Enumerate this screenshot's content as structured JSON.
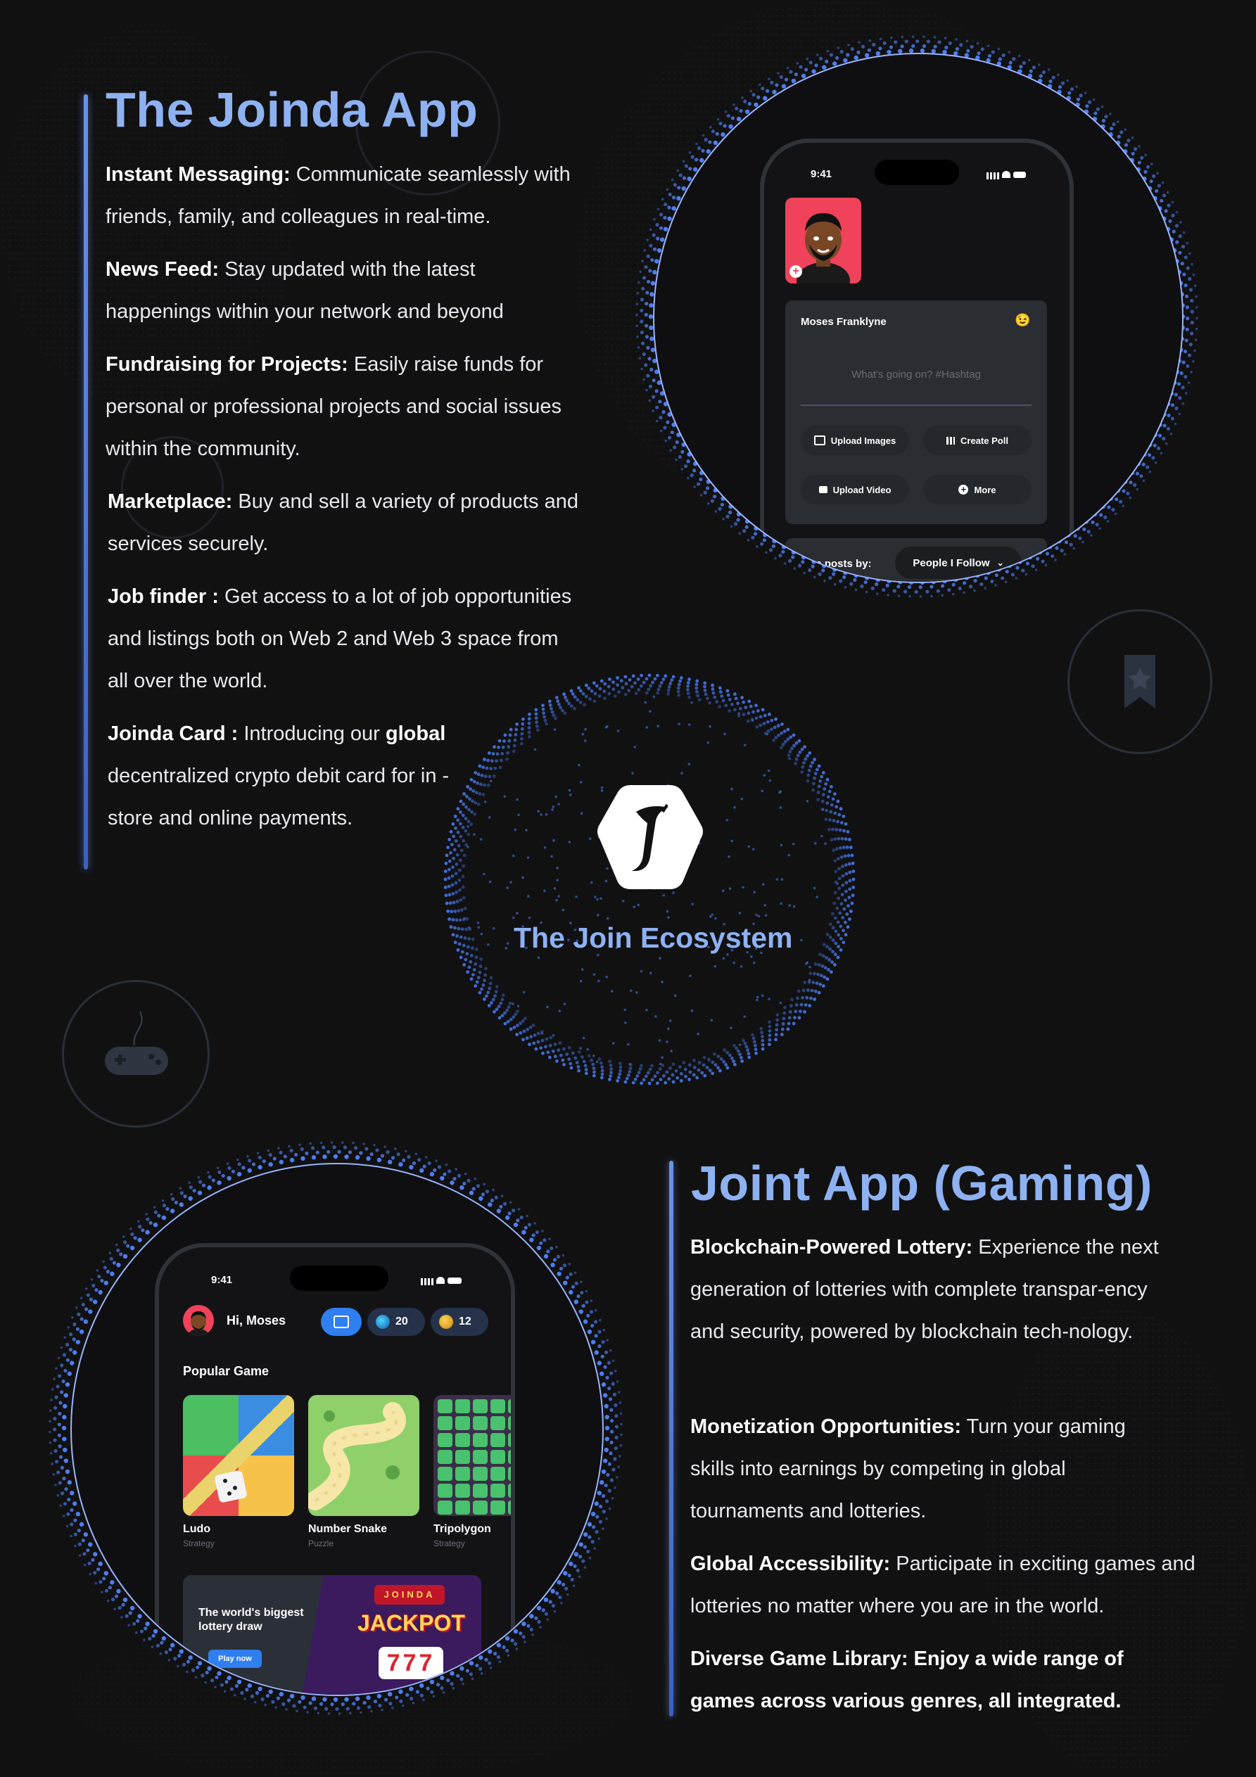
{
  "joinda": {
    "title": "The Joinda App",
    "features": [
      {
        "label": "Instant Messaging:",
        "text": " Communicate seamlessly with friends, family, and colleagues in real-time."
      },
      {
        "label": "News Feed:",
        "text": " Stay updated with the latest happenings within your network and beyond"
      },
      {
        "label": "Fundraising for Projects:",
        "text": " Easily raise funds for personal or professional projects and social issues within the community."
      },
      {
        "label": "Marketplace:",
        "text": " Buy and sell a variety of products and services securely."
      },
      {
        "label": "Job finder :",
        "text": " Get access to a lot of job opportunities and listings both on Web 2 and Web 3 space from all over the world."
      },
      {
        "label": "Joinda Card :",
        "text_before": " Introducing our ",
        "emphasis": "global",
        "text_after": " decentralized crypto debit card for in - store and online payments."
      }
    ],
    "phone": {
      "time": "9:41",
      "user_name": "Moses Franklyne",
      "emoji": "😉",
      "post_placeholder": "What's going on? #Hashtag",
      "actions": [
        "Upload Images",
        "Create Poll",
        "Upload Video",
        "More"
      ],
      "filter_label": "Share posts by:",
      "filter_value": "People I Follow"
    }
  },
  "ecosystem": {
    "title": "The Join Ecosystem"
  },
  "gaming": {
    "title": "Joint App (Gaming)",
    "features": [
      {
        "label": "Blockchain-Powered Lottery:",
        "text": " Experience the next generation of lotteries with complete transpar-ency and security, powered by blockchain tech-nology."
      },
      {
        "label": "Monetization Opportunities:",
        "text": " Turn your gaming skills into earnings by competing in global tournaments and lotteries."
      },
      {
        "label": "Global Accessibility:",
        "text": " Participate in exciting games and lotteries no matter where you are in the world."
      },
      {
        "label": "Diverse Game Library: Enjoy a wide range of games across various genres, all integrated.",
        "text": ""
      }
    ],
    "phone": {
      "time": "9:41",
      "greeting": "Hi, Moses",
      "gems": "20",
      "coins": "12",
      "section_title": "Popular Game",
      "games": [
        {
          "name": "Ludo",
          "category": "Strategy"
        },
        {
          "name": "Number Snake",
          "category": "Puzzle"
        },
        {
          "name": "Tripolygon",
          "category": "Strategy"
        }
      ],
      "banner_title": "The world's biggest lottery draw",
      "banner_button": "Play now",
      "banner_brand": "JOINDA",
      "banner_word": "JACKPOT",
      "banner_digits": "777"
    }
  },
  "colors": {
    "accent": "#8eb1f2",
    "background": "#111112",
    "halo_dots": "#4f7ef0"
  }
}
